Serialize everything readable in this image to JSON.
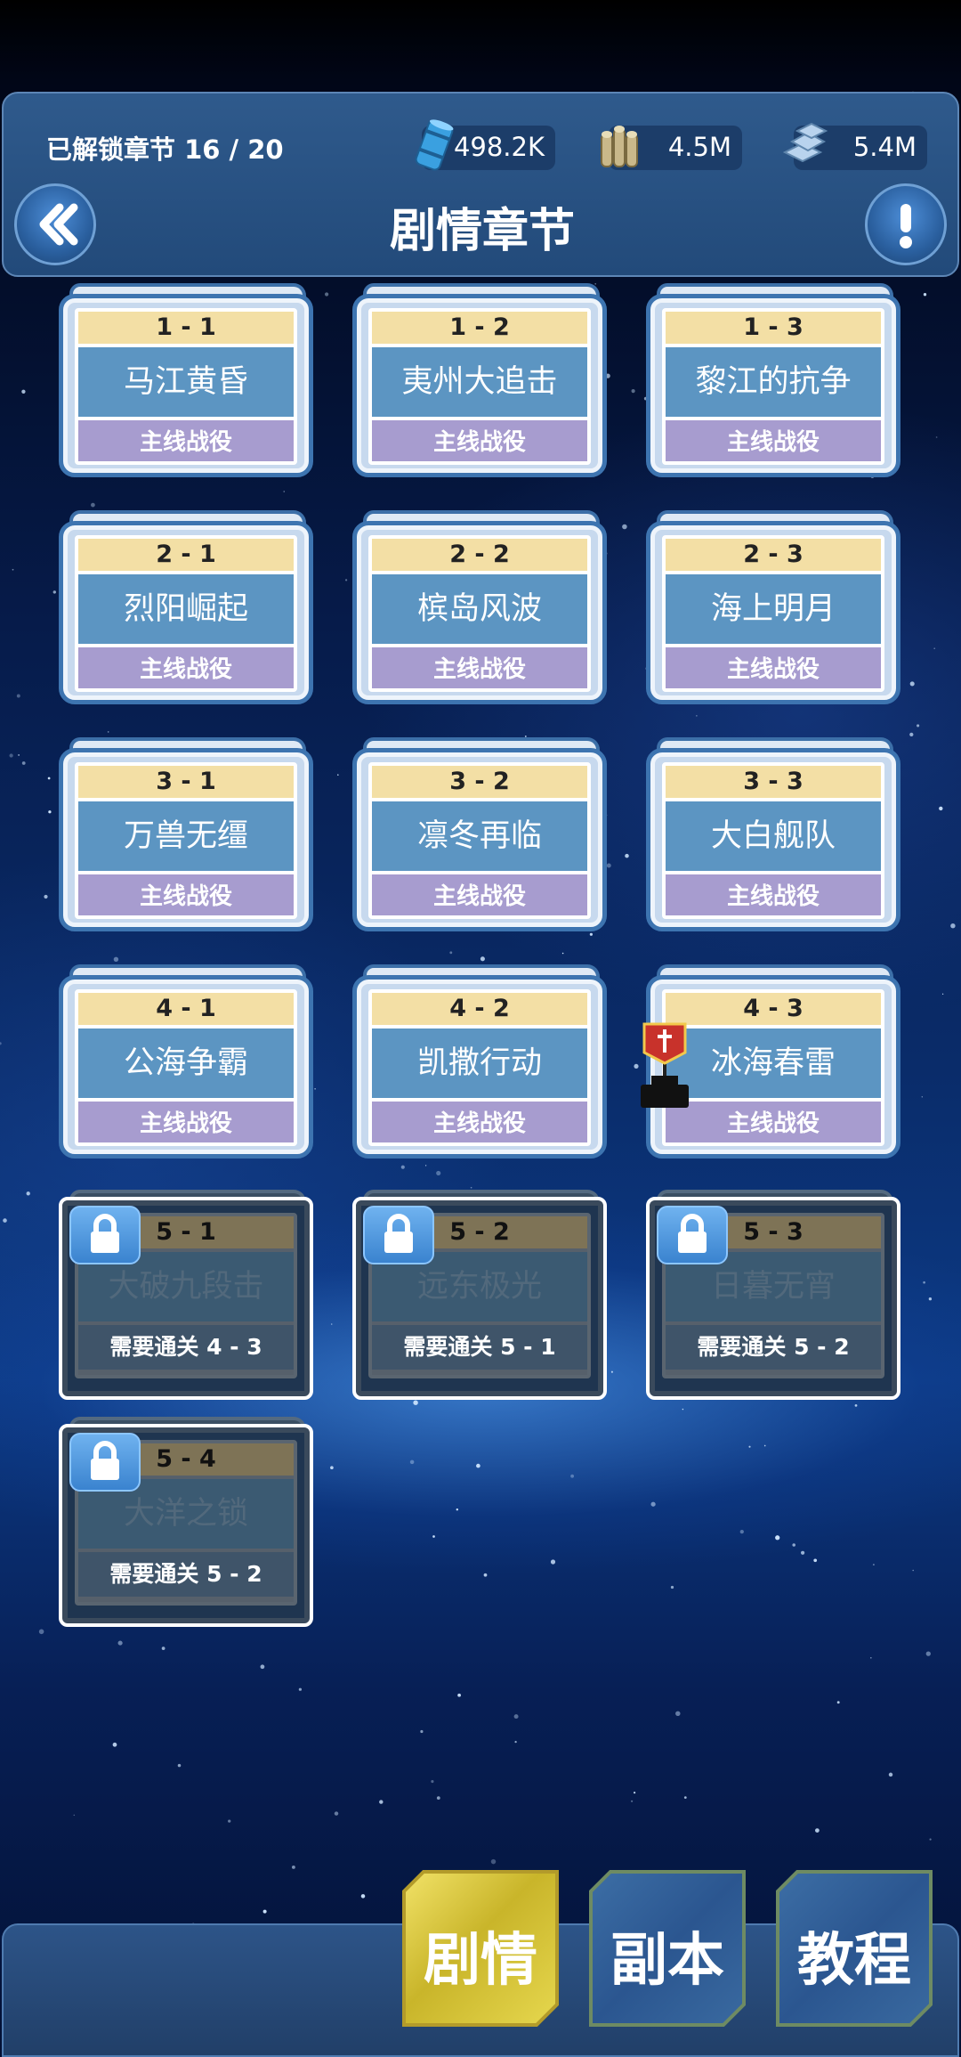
{
  "header": {
    "unlocked_label": "已解锁章节 16 / 20",
    "title": "剧情章节",
    "resources": [
      {
        "icon": "oil-barrel-icon",
        "value": "498.2K"
      },
      {
        "icon": "ammo-shells-icon",
        "value": "4.5M"
      },
      {
        "icon": "steel-icon",
        "value": "5.4M"
      }
    ]
  },
  "chapters": [
    {
      "code": "1 - 1",
      "name": "马江黄昏",
      "tag": "主线战役",
      "locked": false
    },
    {
      "code": "1 - 2",
      "name": "夷州大追击",
      "tag": "主线战役",
      "locked": false
    },
    {
      "code": "1 - 3",
      "name": "黎江的抗争",
      "tag": "主线战役",
      "locked": false
    },
    {
      "code": "2 - 1",
      "name": "烈阳崛起",
      "tag": "主线战役",
      "locked": false
    },
    {
      "code": "2 - 2",
      "name": "槟岛风波",
      "tag": "主线战役",
      "locked": false
    },
    {
      "code": "2 - 3",
      "name": "海上明月",
      "tag": "主线战役",
      "locked": false
    },
    {
      "code": "3 - 1",
      "name": "万兽无缰",
      "tag": "主线战役",
      "locked": false
    },
    {
      "code": "3 - 2",
      "name": "凛冬再临",
      "tag": "主线战役",
      "locked": false
    },
    {
      "code": "3 - 3",
      "name": "大白舰队",
      "tag": "主线战役",
      "locked": false
    },
    {
      "code": "4 - 1",
      "name": "公海争霸",
      "tag": "主线战役",
      "locked": false
    },
    {
      "code": "4 - 2",
      "name": "凯撒行动",
      "tag": "主线战役",
      "locked": false
    },
    {
      "code": "4 - 3",
      "name": "冰海春雷",
      "tag": "主线战役",
      "locked": false
    },
    {
      "code": "5 - 1",
      "name": "大破九段击",
      "tag": "需要通关 4 - 3",
      "locked": true
    },
    {
      "code": "5 - 2",
      "name": "远东极光",
      "tag": "需要通关 5 - 1",
      "locked": true
    },
    {
      "code": "5 - 3",
      "name": "日暮无宵",
      "tag": "需要通关 5 - 2",
      "locked": true
    },
    {
      "code": "5 - 4",
      "name": "大洋之锁",
      "tag": "需要通关 5 - 2",
      "locked": true
    }
  ],
  "tabs": [
    {
      "label": "剧情",
      "active": true
    },
    {
      "label": "副本",
      "active": false
    },
    {
      "label": "教程",
      "active": false
    }
  ],
  "colors": {
    "active_tab": "#e3d24a",
    "card_border": "#3d74b0",
    "code_strip": "#f3dfa5",
    "name_strip": "#5c95c2",
    "tag_strip": "#a79ccf"
  }
}
